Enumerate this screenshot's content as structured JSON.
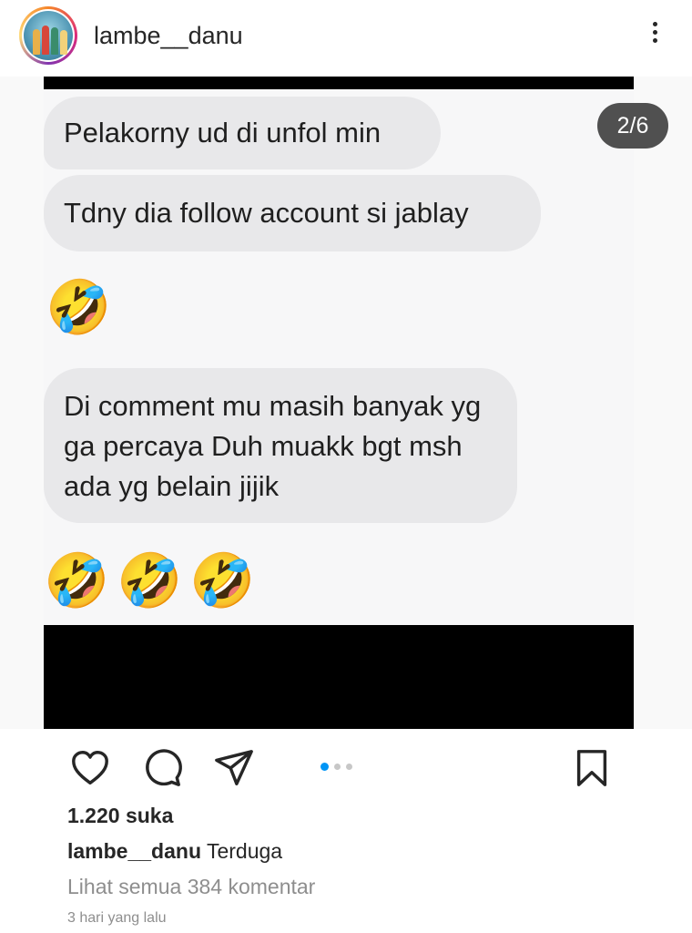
{
  "header": {
    "username": "lambe__danu",
    "avatar_icon": "avatar-photo",
    "more_icon": "more-options-icon"
  },
  "post": {
    "counter": "2/6",
    "messages": [
      "Pelakorny ud di unfol min",
      "Tdny dia follow account si jablay",
      "Di comment mu masih banyak yg ga percaya Duh muakk bgt msh ada yg belain jijik"
    ],
    "emoji": "🤣"
  },
  "actions": {
    "like_icon": "heart-icon",
    "comment_icon": "comment-icon",
    "share_icon": "send-icon",
    "save_icon": "bookmark-icon",
    "carousel_active": 1,
    "carousel_total": 3
  },
  "meta": {
    "likes": "1.220 suka",
    "caption_user": "lambe__danu",
    "caption_text": "Terduga",
    "view_comments": "Lihat semua 384 komentar",
    "time": "3 hari yang lalu"
  },
  "colors": {
    "accent": "#0095f6",
    "text": "#262626",
    "muted": "#8e8e8e",
    "bubble": "#e8e8ea"
  }
}
